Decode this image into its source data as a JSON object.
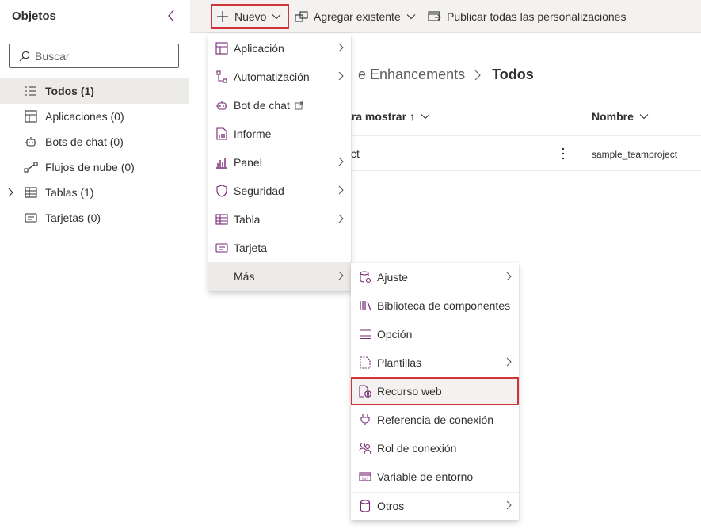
{
  "left_pane": {
    "title": "Objetos",
    "search_placeholder": "Buscar",
    "items": [
      {
        "label": "Todos",
        "count": "(1)",
        "icon": "list-icon",
        "selected": true
      },
      {
        "label": "Aplicaciones",
        "count": "(0)",
        "icon": "apps-icon"
      },
      {
        "label": "Bots de chat",
        "count": "(0)",
        "icon": "bot-icon"
      },
      {
        "label": "Flujos de nube",
        "count": "(0)",
        "icon": "flow-icon"
      },
      {
        "label": "Tablas",
        "count": "(1)",
        "icon": "table-icon",
        "expandable": true
      },
      {
        "label": "Tarjetas",
        "count": "(0)",
        "icon": "card-icon"
      }
    ]
  },
  "command_bar": {
    "new_label": "Nuevo",
    "add_existing_label": "Agregar existente",
    "publish_label": "Publicar todas las personalizaciones"
  },
  "main": {
    "breadcrumb_parent": "e Enhancements",
    "breadcrumb_current": "Todos",
    "column_display": "ara mostrar ↑",
    "column_name": "Nombre",
    "row_display": "ct",
    "row_name": "sample_teamproject"
  },
  "new_menu": {
    "items": [
      {
        "label": "Aplicación",
        "icon": "app-icon",
        "submenu": true
      },
      {
        "label": "Automatización",
        "icon": "automation-icon",
        "submenu": true
      },
      {
        "label": "Bot de chat",
        "icon": "bot-icon",
        "external": true
      },
      {
        "label": "Informe",
        "icon": "report-icon"
      },
      {
        "label": "Panel",
        "icon": "dashboard-icon",
        "submenu": true
      },
      {
        "label": "Seguridad",
        "icon": "shield-icon",
        "submenu": true
      },
      {
        "label": "Tabla",
        "icon": "table-icon",
        "submenu": true
      },
      {
        "label": "Tarjeta",
        "icon": "card-icon"
      },
      {
        "label": "Más",
        "submenu": true,
        "active": true
      }
    ]
  },
  "more_menu": {
    "items": [
      {
        "label": "Ajuste",
        "icon": "setting-icon",
        "submenu": true
      },
      {
        "label": "Biblioteca de componentes",
        "icon": "library-icon"
      },
      {
        "label": "Opción",
        "icon": "option-icon"
      },
      {
        "label": "Plantillas",
        "icon": "template-icon",
        "submenu": true
      },
      {
        "label": "Recurso web",
        "icon": "web-resource-icon",
        "highlighted": true
      },
      {
        "label": "Referencia de conexión",
        "icon": "plug-icon"
      },
      {
        "label": "Rol de conexión",
        "icon": "people-icon"
      },
      {
        "label": "Variable de entorno",
        "icon": "variable-icon"
      },
      {
        "label": "Otros",
        "icon": "database-icon",
        "submenu": true
      }
    ]
  },
  "colors": {
    "accent": "#742774",
    "highlight_border": "#d13438",
    "selected_bg": "#edebe9",
    "commandbar_bg": "#f3f2f1"
  }
}
